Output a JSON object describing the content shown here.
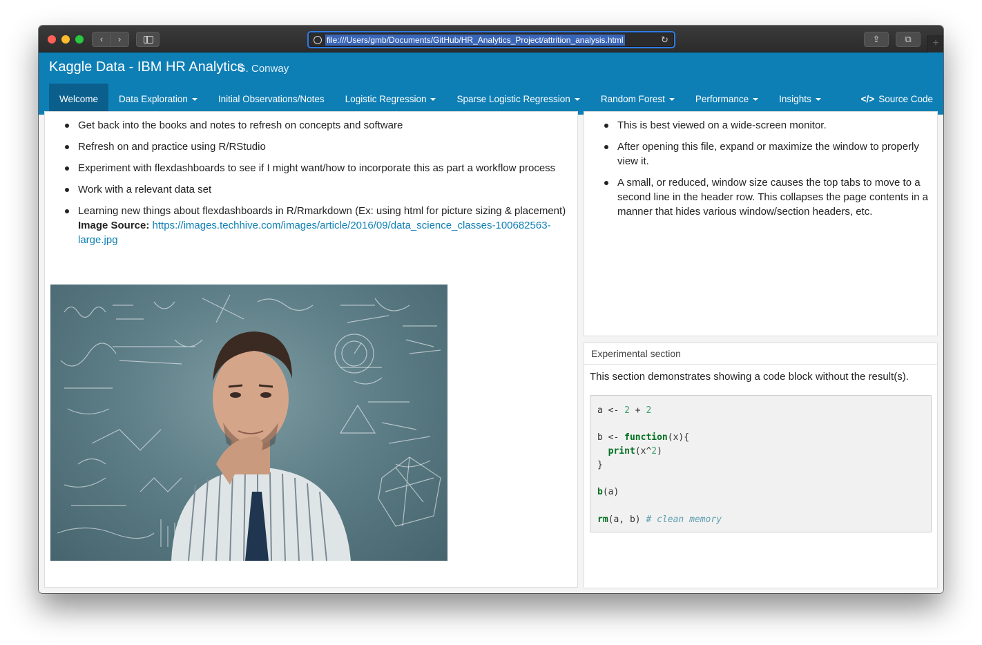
{
  "browser": {
    "url": "file:///Users/gmb/Documents/GitHub/HR_Analytics_Project/attrition_analysis.html"
  },
  "header": {
    "title": "Kaggle Data - IBM HR Analytics",
    "author": "G. Conway",
    "nav": [
      {
        "label": "Welcome",
        "active": true,
        "dropdown": false
      },
      {
        "label": "Data Exploration",
        "dropdown": true
      },
      {
        "label": "Initial Observations/Notes",
        "dropdown": false
      },
      {
        "label": "Logistic Regression",
        "dropdown": true
      },
      {
        "label": "Sparse Logistic Regression",
        "dropdown": true
      },
      {
        "label": "Random Forest",
        "dropdown": true
      },
      {
        "label": "Performance",
        "dropdown": true
      },
      {
        "label": "Insights",
        "dropdown": true
      }
    ],
    "source_code": "Source Code"
  },
  "left_panel": {
    "bullets": [
      "Get back into the books and notes to refresh on concepts and software",
      "Refresh on and practice using R/RStudio",
      "Experiment with flexdashboards to see if I might want/how to incorporate this as part a workflow process",
      "Work with a relevant data set",
      "Learning new things about flexdashboards in R/Rmarkdown (Ex: using html for picture sizing & placement)"
    ],
    "image_source_label": "Image Source:",
    "image_source_url": "https://images.techhive.com/images/article/2016/09/data_science_classes-100682563-large.jpg"
  },
  "right_top": {
    "bullets": [
      "This is best viewed on a wide-screen monitor.",
      "After opening this file, expand or maximize the window to properly view it.",
      "A small, or reduced, window size causes the top tabs to move to a second line in the header row. This collapses the page contents in a manner that hides various window/section headers, etc."
    ]
  },
  "experimental": {
    "title": "Experimental section",
    "text": "This section demonstrates showing a code block without the result(s).",
    "code": {
      "line1_a": "a <- ",
      "line1_n1": "2",
      "line1_op": " + ",
      "line1_n2": "2",
      "line3_a": "b <- ",
      "line3_kw": "function",
      "line3_rest": "(x){",
      "line4_indent": "  ",
      "line4_kw": "print",
      "line4_a": "(x^",
      "line4_n": "2",
      "line4_b": ")",
      "line5": "}",
      "line7_kw": "b",
      "line7_rest": "(a)",
      "line9_kw": "rm",
      "line9_rest": "(a, b) ",
      "line9_cm": "# clean memory"
    }
  }
}
